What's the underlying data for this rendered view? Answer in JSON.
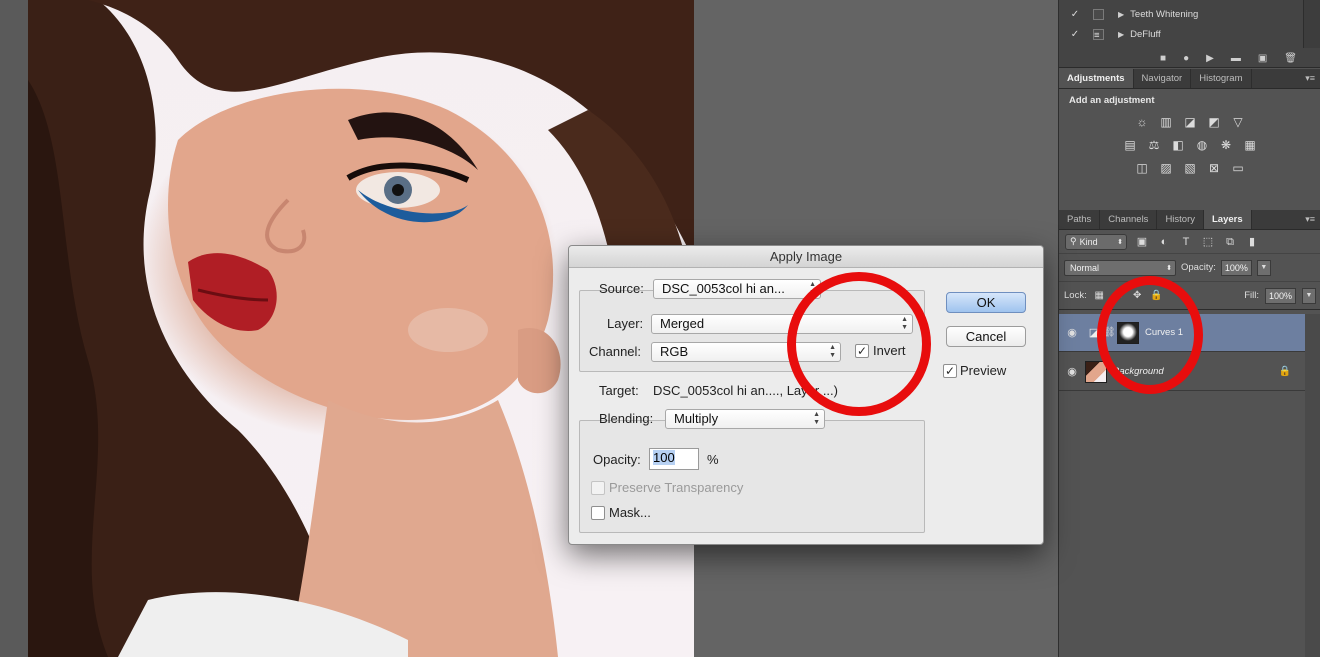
{
  "actions_panel": {
    "rows": [
      {
        "checked": "✓",
        "label": "Teeth Whitening"
      },
      {
        "checked": "✓",
        "label": "DeFluff"
      }
    ],
    "toolbar_icons": [
      "stop-icon",
      "record-icon",
      "play-icon",
      "new-set-icon",
      "new-action-icon",
      "delete-icon"
    ]
  },
  "adjustments_panel": {
    "tabs": [
      "Adjustments",
      "Navigator",
      "Histogram"
    ],
    "active_tab": "Adjustments",
    "title": "Add an adjustment"
  },
  "layers_panel": {
    "tabs": [
      "Paths",
      "Channels",
      "History",
      "Layers"
    ],
    "active_tab": "Layers",
    "kind_label": "Kind",
    "blend_mode": "Normal",
    "opacity_label": "Opacity:",
    "opacity_value": "100%",
    "lock_label": "Lock:",
    "fill_label": "Fill:",
    "fill_value": "100%",
    "layers": [
      {
        "name": "Curves 1",
        "selected": true
      },
      {
        "name": "Background",
        "selected": false
      }
    ]
  },
  "dialog": {
    "title": "Apply Image",
    "source_label": "Source:",
    "source_value": "DSC_0053col hi an...",
    "layer_label": "Layer:",
    "layer_value": "Merged",
    "channel_label": "Channel:",
    "channel_value": "RGB",
    "invert_label": "Invert",
    "invert_checked": true,
    "target_label": "Target:",
    "target_value": "DSC_0053col hi an...., Layer ...)",
    "blending_label": "Blending:",
    "blending_value": "Multiply",
    "opacity_label": "Opacity:",
    "opacity_value": "100",
    "opacity_unit": "%",
    "preserve_label": "Preserve Transparency",
    "mask_label": "Mask...",
    "ok_label": "OK",
    "cancel_label": "Cancel",
    "preview_label": "Preview",
    "preview_checked": true
  },
  "colors": {
    "annotation_ring": "#e80d0d",
    "selected_layer": "#6d7fa0",
    "dock_bg": "#535353"
  }
}
